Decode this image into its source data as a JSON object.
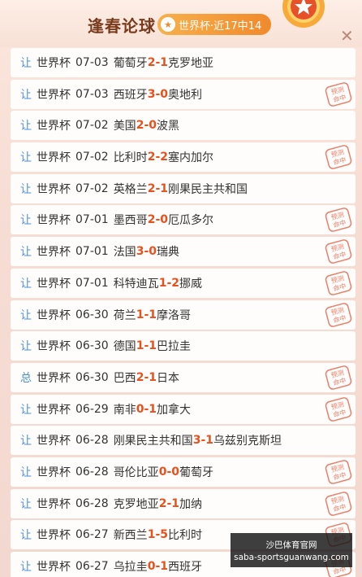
{
  "header": {
    "title": "逢春论球",
    "badge": "世界杯·近17中14",
    "star_icon": "star-icon",
    "medal_icon": "medal-icon",
    "close_icon": "close-icon"
  },
  "accent_color": "#e8501c",
  "tag_color": "#4a90e2",
  "matches": [
    {
      "tag": "让",
      "league": "世界杯",
      "date": "07-03",
      "home": "葡萄牙",
      "hs": "2",
      "as": "1",
      "away": "克罗地亚",
      "hit": false
    },
    {
      "tag": "让",
      "league": "世界杯",
      "date": "07-03",
      "home": "西班牙",
      "hs": "3",
      "as": "0",
      "away": "奥地利",
      "hit": true
    },
    {
      "tag": "让",
      "league": "世界杯",
      "date": "07-02",
      "home": "美国",
      "hs": "2",
      "as": "0",
      "away": "波黑",
      "hit": false
    },
    {
      "tag": "让",
      "league": "世界杯",
      "date": "07-02",
      "home": "比利时",
      "hs": "2",
      "as": "2",
      "away": "塞内加尔",
      "hit": true
    },
    {
      "tag": "让",
      "league": "世界杯",
      "date": "07-02",
      "home": "英格兰",
      "hs": "2",
      "as": "1",
      "away": "刚果民主共和国",
      "hit": false
    },
    {
      "tag": "让",
      "league": "世界杯",
      "date": "07-01",
      "home": "墨西哥",
      "hs": "2",
      "as": "0",
      "away": "厄瓜多尔",
      "hit": true
    },
    {
      "tag": "让",
      "league": "世界杯",
      "date": "07-01",
      "home": "法国",
      "hs": "3",
      "as": "0",
      "away": "瑞典",
      "hit": true
    },
    {
      "tag": "让",
      "league": "世界杯",
      "date": "07-01",
      "home": "科特迪瓦",
      "hs": "1",
      "as": "2",
      "away": "挪威",
      "hit": true
    },
    {
      "tag": "让",
      "league": "世界杯",
      "date": "06-30",
      "home": "荷兰",
      "hs": "1",
      "as": "1",
      "away": "摩洛哥",
      "hit": true
    },
    {
      "tag": "让",
      "league": "世界杯",
      "date": "06-30",
      "home": "德国",
      "hs": "1",
      "as": "1",
      "away": "巴拉圭",
      "hit": false
    },
    {
      "tag": "总",
      "league": "世界杯",
      "date": "06-30",
      "home": "巴西",
      "hs": "2",
      "as": "1",
      "away": "日本",
      "hit": true
    },
    {
      "tag": "让",
      "league": "世界杯",
      "date": "06-29",
      "home": "南非",
      "hs": "0",
      "as": "1",
      "away": "加拿大",
      "hit": true
    },
    {
      "tag": "让",
      "league": "世界杯",
      "date": "06-28",
      "home": "刚果民主共和国",
      "hs": "3",
      "as": "1",
      "away": "乌兹别克斯坦",
      "hit": false
    },
    {
      "tag": "让",
      "league": "世界杯",
      "date": "06-28",
      "home": "哥伦比亚",
      "hs": "0",
      "as": "0",
      "away": "葡萄牙",
      "hit": true
    },
    {
      "tag": "让",
      "league": "世界杯",
      "date": "06-28",
      "home": "克罗地亚",
      "hs": "2",
      "as": "1",
      "away": "加纳",
      "hit": true
    },
    {
      "tag": "让",
      "league": "世界杯",
      "date": "06-27",
      "home": "新西兰",
      "hs": "1",
      "as": "5",
      "away": "比利时",
      "hit": true
    },
    {
      "tag": "让",
      "league": "世界杯",
      "date": "06-27",
      "home": "乌拉圭",
      "hs": "0",
      "as": "1",
      "away": "西班牙",
      "hit": true
    }
  ],
  "stamp_text": [
    "预测",
    "命中"
  ],
  "watermark": {
    "line1": "沙巴体育官网",
    "line2": "saba-sportsguanwang.com"
  }
}
